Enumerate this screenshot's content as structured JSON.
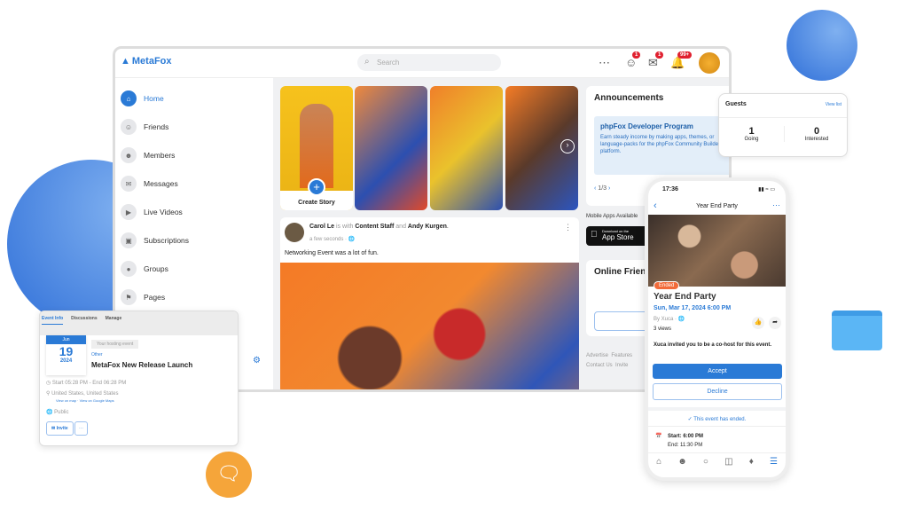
{
  "header": {
    "logo": "MetaFox",
    "search_placeholder": "Search",
    "friend_badge": "1",
    "message_badge": "1",
    "notification_badge": "99+"
  },
  "sidebar": {
    "items": [
      {
        "label": "Home",
        "icon": "home-icon"
      },
      {
        "label": "Friends",
        "icon": "friends-icon"
      },
      {
        "label": "Members",
        "icon": "members-icon"
      },
      {
        "label": "Messages",
        "icon": "messages-icon"
      },
      {
        "label": "Live Videos",
        "icon": "video-icon"
      },
      {
        "label": "Subscriptions",
        "icon": "subscriptions-icon"
      },
      {
        "label": "Groups",
        "icon": "groups-icon"
      },
      {
        "label": "Pages",
        "icon": "flag-icon"
      }
    ]
  },
  "stories": {
    "create_label": "Create Story"
  },
  "post": {
    "author": "Carol Le",
    "is_with": "is with",
    "tag1": "Content Staff",
    "and": "and",
    "tag2": "Andy Kurgen",
    "time": "a few seconds · ",
    "text": "Networking Event was a lot of fun."
  },
  "announcements": {
    "title": "Announcements",
    "headline": "phpFox Developer Program",
    "body": "Earn steady income by making apps, themes, or language-packs for the phpFox Community Builder platform.",
    "pager": "1/3"
  },
  "mobile_apps": {
    "label": "Mobile Apps Available",
    "app_store_small": "Download on the",
    "app_store": "App Store"
  },
  "online_friends": {
    "title": "Online Friends",
    "empty": "No"
  },
  "footer_links": [
    "Advertise",
    "Features",
    "Contact Us",
    "Invite"
  ],
  "guests": {
    "title": "Guests",
    "view_list": "View list",
    "going_count": "1",
    "going_label": "Going",
    "interested_count": "0",
    "interested_label": "Interested"
  },
  "phone": {
    "time": "17:36",
    "title": "Year End Party",
    "status": "Ended",
    "event_title": "Year End Party",
    "date": "Sun, Mar 17, 2024 6:00 PM",
    "by": "By Xuca · ",
    "views": "3 views",
    "invite_text": "Xuca invited you to be a co-host for this event.",
    "accept": "Accept",
    "decline": "Decline",
    "ended_notice": "This event has ended.",
    "start": "Start: 6:00 PM",
    "end": "End: 11:30 PM"
  },
  "event_card": {
    "tabs": [
      "Event Info",
      "Discussions",
      "Manage"
    ],
    "month": "Jun",
    "day": "19",
    "year": "2024",
    "hosting_badge": "Your hosting event",
    "category": "Other",
    "title": "MetaFox New Release Launch",
    "time": "Start 05:28 PM - End 06:28 PM",
    "location": "United States, United States",
    "view_map": "View on map",
    "view_google": "View on Google Maps",
    "privacy": "Public",
    "invite": "Invite"
  },
  "colors": {
    "accent": "#2a7ad6",
    "badge": "#e0202f",
    "ended": "#f26b3a",
    "chat_bubble": "#f5a53a"
  }
}
